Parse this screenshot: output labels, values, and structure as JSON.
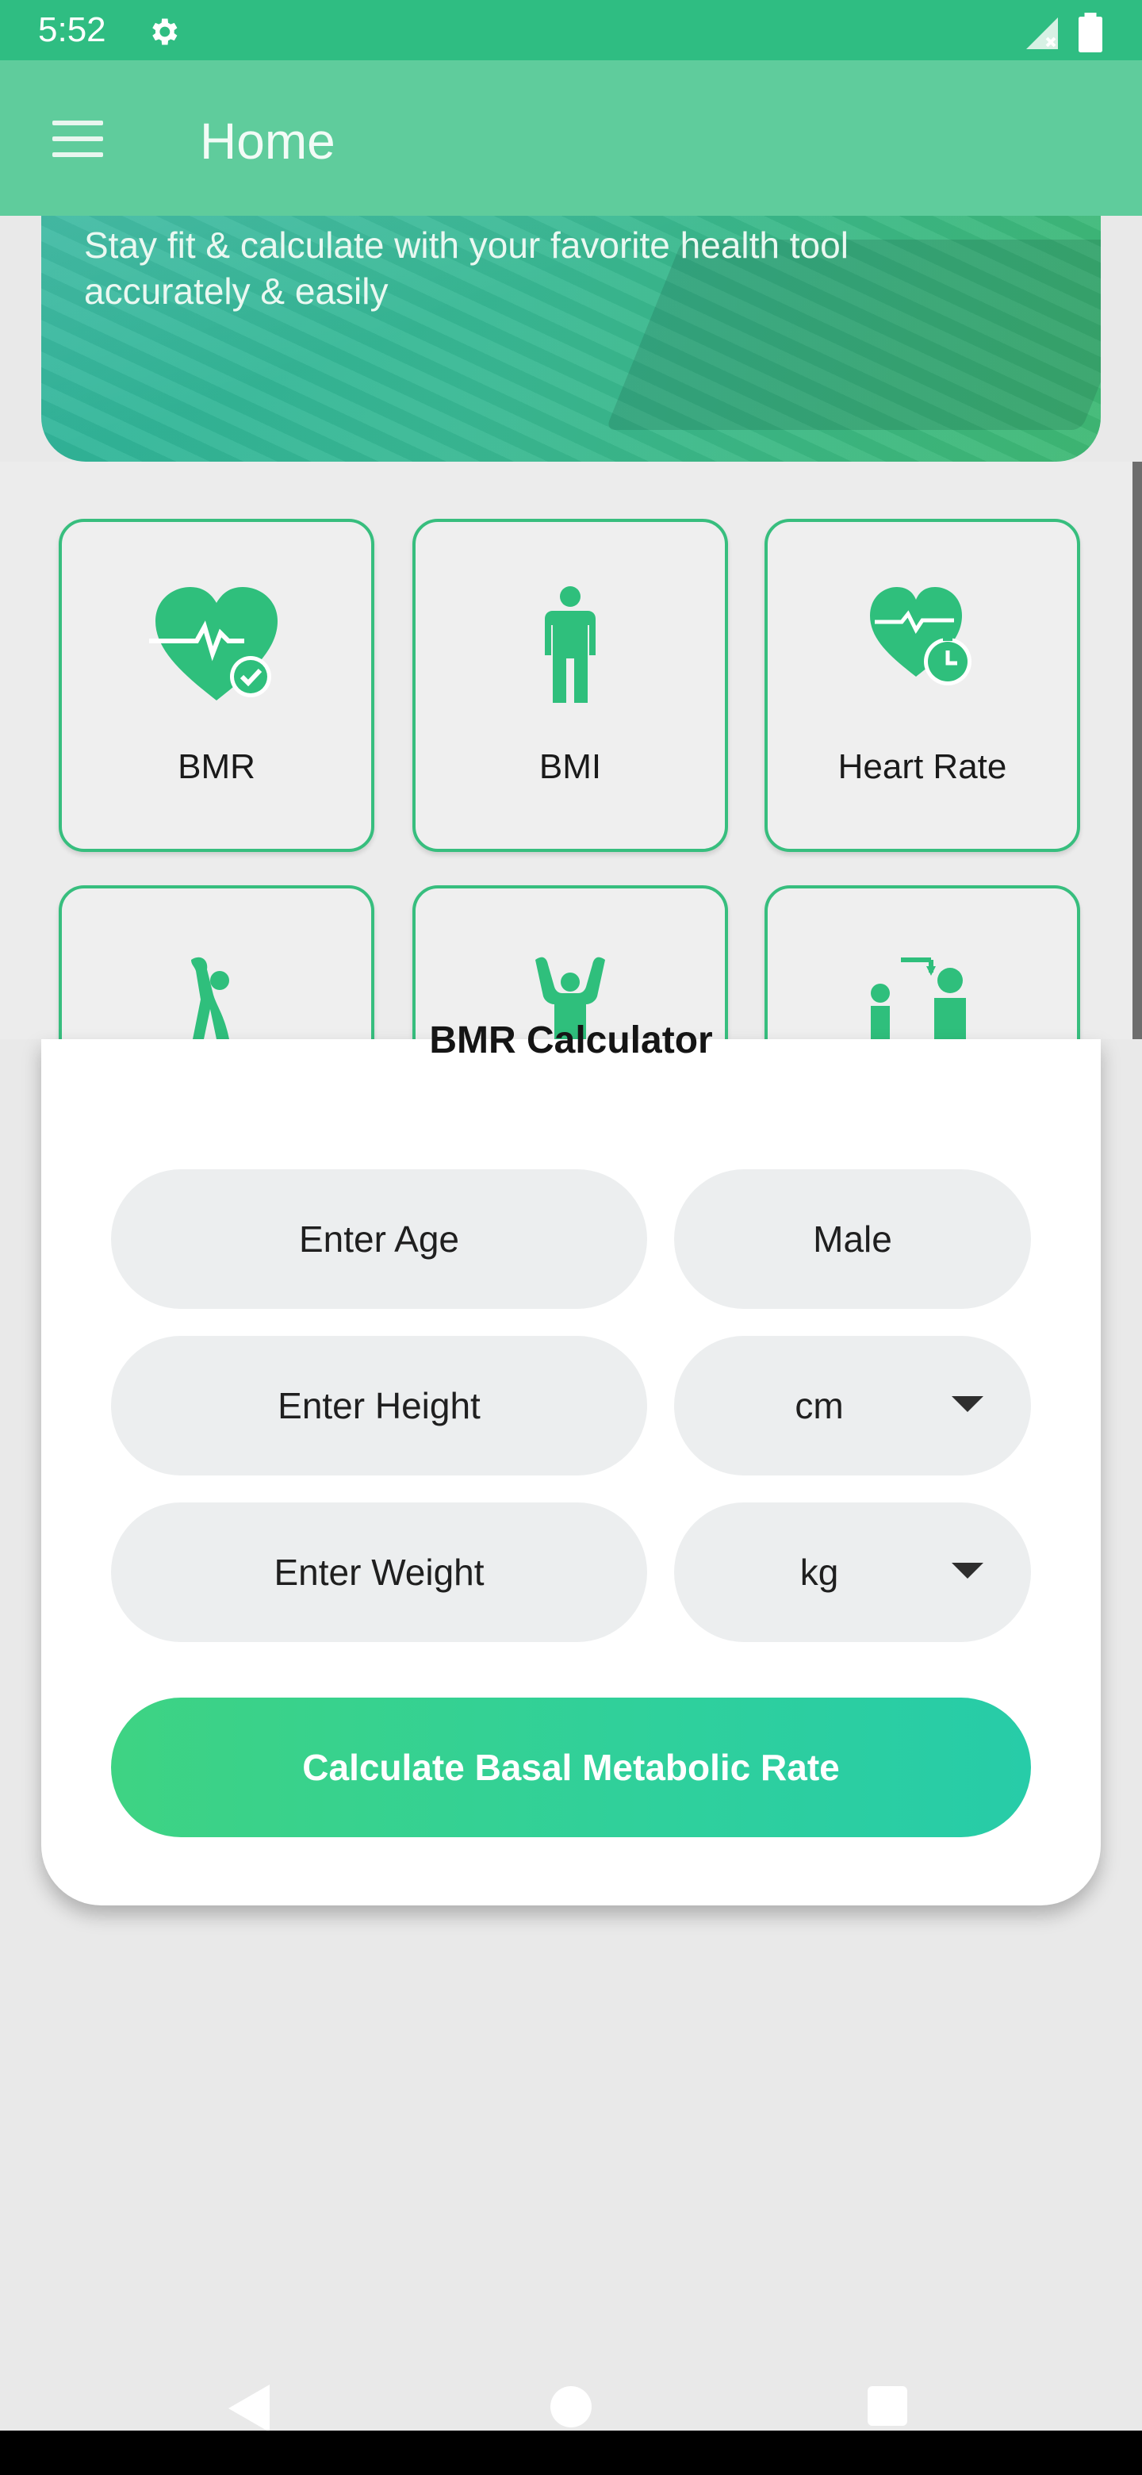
{
  "status_bar": {
    "time": "5:52",
    "icons": [
      "settings-gear-icon",
      "signal-icon",
      "battery-icon"
    ]
  },
  "app_bar": {
    "title": "Home",
    "menu_icon": "hamburger-icon"
  },
  "banner": {
    "text": "Stay fit & calculate with your favorite health tool accurately & easily"
  },
  "tools": [
    {
      "label": "BMR",
      "icon": "heart-check-icon"
    },
    {
      "label": "BMI",
      "icon": "person-icon"
    },
    {
      "label": "Heart Rate",
      "icon": "heart-timer-icon"
    },
    {
      "label": "",
      "icon": "stretching-icon"
    },
    {
      "label": "",
      "icon": "strong-person-icon"
    },
    {
      "label": "",
      "icon": "height-measure-icon"
    }
  ],
  "calculator": {
    "title": "BMR Calculator",
    "age_placeholder": "Enter Age",
    "gender_value": "Male",
    "height_placeholder": "Enter Height",
    "height_unit": "cm",
    "weight_placeholder": "Enter Weight",
    "weight_unit": "kg",
    "submit_label": "Calculate Basal Metabolic Rate"
  },
  "colors": {
    "primary": "#2fbd82",
    "app_bar": "#5fcc9c",
    "accent_green": "#37be7e",
    "field_bg": "#eceeef"
  }
}
